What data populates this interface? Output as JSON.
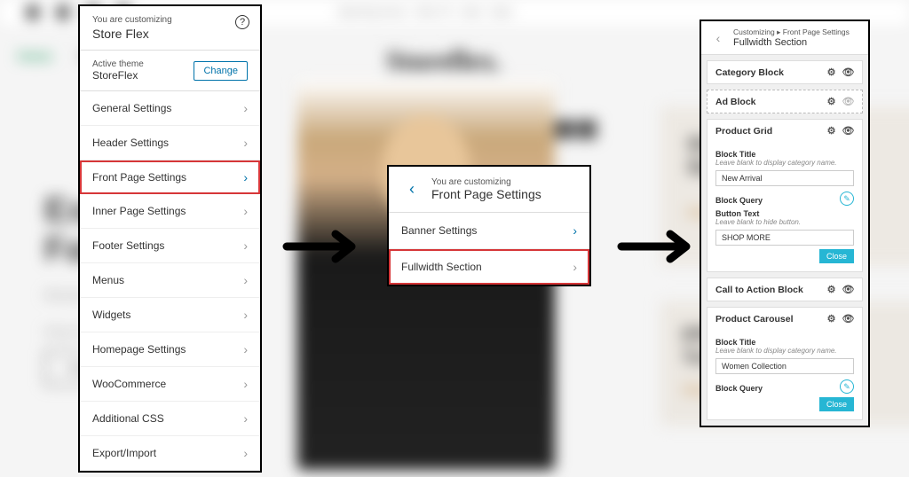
{
  "background": {
    "opening_hours": "Opening hours · Mon Fri · 8am - 8pm",
    "nav_home": "Home",
    "nav_shop": "Shop",
    "logo": "Storeflex.",
    "hero_line1": "Exp",
    "hero_line2": "Fas",
    "hero_p1": "Marzipan",
    "hero_p2": "icing cha",
    "hero_btn": "Shop",
    "card1_line1": "Show You",
    "card1_line2": "Style",
    "card1_link": "Shop Now →",
    "card2_line1": "Effortless",
    "card2_line2": "Trend",
    "card2_link": "Shop Now →"
  },
  "panel1": {
    "subtitle": "You are customizing",
    "title": "Store Flex",
    "active_theme_label": "Active theme",
    "active_theme_name": "StoreFlex",
    "change_button": "Change",
    "items": [
      {
        "label": "General Settings"
      },
      {
        "label": "Header Settings"
      },
      {
        "label": "Front Page Settings"
      },
      {
        "label": "Inner Page Settings"
      },
      {
        "label": "Footer Settings"
      },
      {
        "label": "Menus"
      },
      {
        "label": "Widgets"
      },
      {
        "label": "Homepage Settings"
      },
      {
        "label": "WooCommerce"
      },
      {
        "label": "Additional CSS"
      },
      {
        "label": "Export/Import"
      }
    ]
  },
  "panel2": {
    "subtitle": "You are customizing",
    "title": "Front Page Settings",
    "items": [
      {
        "label": "Banner Settings"
      },
      {
        "label": "Fullwidth Section"
      }
    ]
  },
  "panel3": {
    "breadcrumb": "Customizing ▸ Front Page Settings",
    "title": "Fullwidth Section",
    "blocks": {
      "category": "Category Block",
      "ad": "Ad Block",
      "product_grid": {
        "name": "Product Grid",
        "block_title_label": "Block Title",
        "block_title_hint": "Leave blank to display category name.",
        "block_title_value": "New Arrival",
        "block_query_label": "Block Query",
        "button_text_label": "Button Text",
        "button_text_hint": "Leave blank to hide button.",
        "button_text_value": "SHOP MORE",
        "close": "Close"
      },
      "cta": "Call to Action Block",
      "product_carousel": {
        "name": "Product Carousel",
        "block_title_label": "Block Title",
        "block_title_hint": "Leave blank to display category name.",
        "block_title_value": "Women Collection",
        "block_query_label": "Block Query",
        "close": "Close"
      }
    }
  }
}
